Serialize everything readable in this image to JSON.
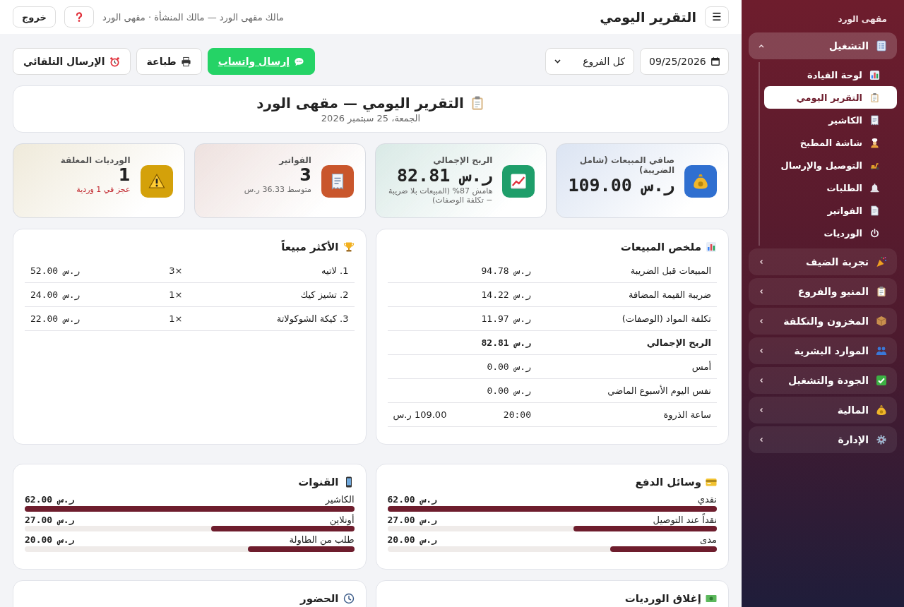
{
  "header": {
    "menu_button": "☰",
    "title": "التقرير اليومي",
    "user_line": "مالك مقهى الورد — مالك المنشأة · مقهى الورد",
    "logout_button": "خروج"
  },
  "toolbar": {
    "date_value": "09/25/2026",
    "branch_select": "كل الفروع",
    "buttons": [
      {
        "label": "إرسال واتساب",
        "kind": "whatsapp"
      },
      {
        "label": "طباعة",
        "kind": "print"
      },
      {
        "label": "الإرسال التلقائي",
        "kind": "schedule"
      }
    ]
  },
  "report_title": {
    "title": "التقرير اليومي — مقهى الورد",
    "date": "الجمعة، 25 سبتمبر 2026"
  },
  "kpis": [
    {
      "label": "صافي المبيعات (شامل الضريبة)",
      "value": "ر.س 109.00",
      "kind": "money",
      "color": "#2f6fd0"
    },
    {
      "label": "الربح الإجمالي",
      "value": "ر.س 82.81",
      "note": "هامش 87% (المبيعات بلا ضريبة − تكلفة الوصفات)",
      "alert": false,
      "kind": "money",
      "color": "#1e9e6a"
    },
    {
      "label": "الفواتير",
      "value": "3",
      "note": "متوسط 36.33 ر.س",
      "alert": false,
      "kind": "count",
      "color": "#c9562c"
    },
    {
      "label": "الورديات المغلقة",
      "value": "1",
      "note": "عجز في 1 وردية",
      "alert": true,
      "kind": "count",
      "color": "#d4a10a"
    }
  ],
  "sales_summary": {
    "title": "ملخص المبيعات",
    "rows": [
      {
        "label": "المبيعات قبل الضريبة",
        "value": "ر.س 94.78",
        "bold": false
      },
      {
        "label": "ضريبة القيمة المضافة",
        "value": "ر.س 14.22",
        "bold": false
      },
      {
        "label": "تكلفة المواد (الوصفات)",
        "value": "ر.س 11.97",
        "bold": false
      },
      {
        "label": "الربح الإجمالي",
        "value": "ر.س 82.81",
        "bold": true
      },
      {
        "label": "أمس",
        "value": "ر.س 0.00",
        "bold": false
      },
      {
        "label": "نفس اليوم الأسبوع الماضي",
        "value": "ر.س 0.00",
        "bold": false
      },
      {
        "label": "ساعة الذروة",
        "value": "20:00",
        "column_3": "109.00 ر.س",
        "bold": false
      }
    ]
  },
  "top_sellers": {
    "title": "الأكثر مبيعاً",
    "rows": [
      {
        "name": "1. لاتيه",
        "qty": "×3",
        "value": "ر.س 52.00"
      },
      {
        "name": "2. تشيز كيك",
        "qty": "×1",
        "value": "ر.س 24.00"
      },
      {
        "name": "3. كيكة الشوكولاتة",
        "qty": "×1",
        "value": "ر.س 22.00"
      }
    ]
  },
  "payment_methods": {
    "title": "وسائل الدفع",
    "rows": [
      {
        "label": "نقدي",
        "value": "ر.س 62.00",
        "level": 1.0
      },
      {
        "label": "نقداً عند التوصيل",
        "value": "ر.س 27.00",
        "level": 0.435
      },
      {
        "label": "مدى",
        "value": "ر.س 20.00",
        "level": 0.323
      }
    ]
  },
  "channels": {
    "title": "القنوات",
    "rows": [
      {
        "label": "الكاشير",
        "value": "ر.س 62.00",
        "level": 1.0
      },
      {
        "label": "أونلاين",
        "value": "ر.س 27.00",
        "level": 0.435
      },
      {
        "label": "طلب من الطاولة",
        "value": "ر.س 20.00",
        "level": 0.323
      }
    ]
  },
  "bottom_panels": [
    {
      "title": "إغلاق الورديات"
    },
    {
      "title": "الحضور"
    }
  ],
  "sidebar": {
    "brand": "مقهى الورد",
    "groups": [
      {
        "label": "التشغيل",
        "expanded": true,
        "children": [
          {
            "label": "لوحة القيادة",
            "selected": false
          },
          {
            "label": "التقرير اليومي",
            "selected": true
          },
          {
            "label": "الكاشير",
            "selected": false
          },
          {
            "label": "شاشة المطبخ",
            "selected": false
          },
          {
            "label": "التوصيل والإرسال",
            "selected": false
          },
          {
            "label": "الطلبات",
            "selected": false
          },
          {
            "label": "الفواتير",
            "selected": false
          },
          {
            "label": "الورديات",
            "selected": false
          }
        ]
      },
      {
        "label": "تجربة الضيف",
        "expanded": false
      },
      {
        "label": "المنيو والفروع",
        "expanded": false
      },
      {
        "label": "المخزون والتكلفة",
        "expanded": false
      },
      {
        "label": "الموارد البشرية",
        "expanded": false
      },
      {
        "label": "الجودة والتشغيل",
        "expanded": false
      },
      {
        "label": "المالية",
        "expanded": false
      },
      {
        "label": "الإدارة",
        "expanded": false
      }
    ]
  }
}
